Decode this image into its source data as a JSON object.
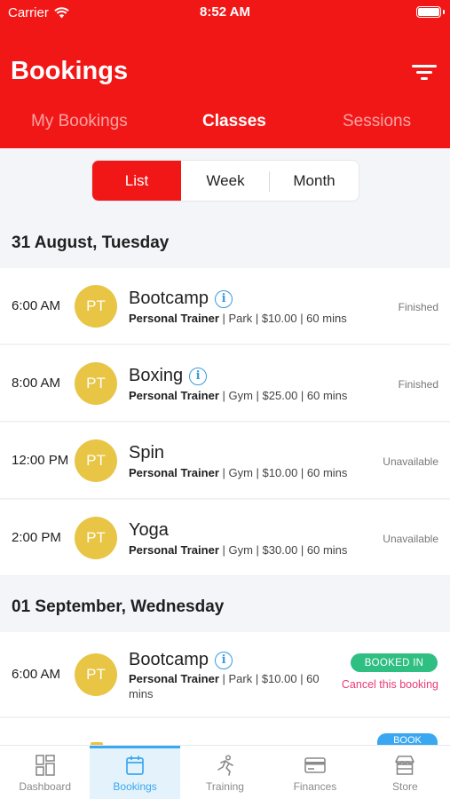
{
  "status_bar": {
    "carrier": "Carrier",
    "time": "8:52 AM"
  },
  "header": {
    "title": "Bookings"
  },
  "tabs": [
    {
      "label": "My Bookings"
    },
    {
      "label": "Classes"
    },
    {
      "label": "Sessions"
    }
  ],
  "view_toggle": [
    {
      "label": "List"
    },
    {
      "label": "Week"
    },
    {
      "label": "Month"
    }
  ],
  "days": [
    {
      "heading": "31 August, Tuesday",
      "classes": [
        {
          "time": "6:00 AM",
          "avatar": "PT",
          "name": "Bootcamp",
          "trainer": "Personal Trainer",
          "details": " | Park | $10.00 | 60 mins",
          "status": "Finished"
        },
        {
          "time": "8:00 AM",
          "avatar": "PT",
          "name": "Boxing",
          "trainer": "Personal Trainer",
          "details": " | Gym | $25.00 | 60 mins",
          "status": "Finished"
        },
        {
          "time": "12:00 PM",
          "avatar": "PT",
          "name": "Spin",
          "trainer": "Personal Trainer",
          "details": " | Gym | $10.00 | 60 mins",
          "status": "Unavailable"
        },
        {
          "time": "2:00 PM",
          "avatar": "PT",
          "name": "Yoga",
          "trainer": "Personal Trainer",
          "details": " | Gym | $30.00 | 60 mins",
          "status": "Unavailable"
        }
      ]
    },
    {
      "heading": "01 September, Wednesday",
      "classes": [
        {
          "time": "6:00 AM",
          "avatar": "PT",
          "name": "Bootcamp",
          "trainer": "Personal Trainer",
          "details": " | Park | $10.00 | 60",
          "details2": "mins",
          "badge": "BOOKED IN",
          "action": "Cancel this booking"
        }
      ]
    }
  ],
  "next_badge": "BOOK",
  "bottom_nav": [
    {
      "label": "Dashboard",
      "icon": "dashboard-icon"
    },
    {
      "label": "Bookings",
      "icon": "calendar-icon"
    },
    {
      "label": "Training",
      "icon": "running-icon"
    },
    {
      "label": "Finances",
      "icon": "card-icon"
    },
    {
      "label": "Store",
      "icon": "store-icon"
    }
  ],
  "colors": {
    "brand": "#f21717",
    "accent": "#3aa8f0",
    "avatar": "#e8c545",
    "booked": "#2fbf82",
    "cancel": "#ea3b73"
  }
}
